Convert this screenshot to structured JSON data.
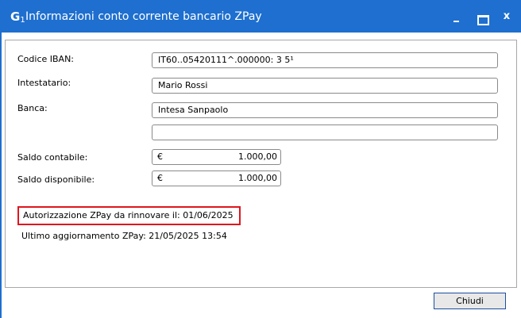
{
  "window": {
    "icon_letter": "G",
    "icon_sub": "1",
    "title": "Informazioni conto corrente bancario ZPay",
    "min_glyph": "_",
    "close_glyph": "x"
  },
  "form": {
    "iban": {
      "label": "Codice IBAN:",
      "value": "IT60..05420111^.000000: 3 5¹"
    },
    "holder": {
      "label": "Intestatario:",
      "value": "Mario Rossi"
    },
    "bank": {
      "label": "Banca:",
      "value": "Intesa Sanpaolo",
      "extra_value": ""
    },
    "saldo_contabile": {
      "label": "Saldo contabile:",
      "currency": "€",
      "value": "1.000,00"
    },
    "saldo_disponibile": {
      "label": "Saldo disponibile:",
      "currency": "€",
      "value": "1.000,00"
    }
  },
  "status": {
    "authorization": "Autorizzazione ZPay da rinnovare il: 01/06/2025",
    "last_update": "Ultimo aggiornamento ZPay: 21/05/2025 13:54"
  },
  "buttons": {
    "close_label": "Chiudi"
  },
  "colors": {
    "titlebar": "#1e6fcf",
    "highlight_border": "#e0151d"
  }
}
